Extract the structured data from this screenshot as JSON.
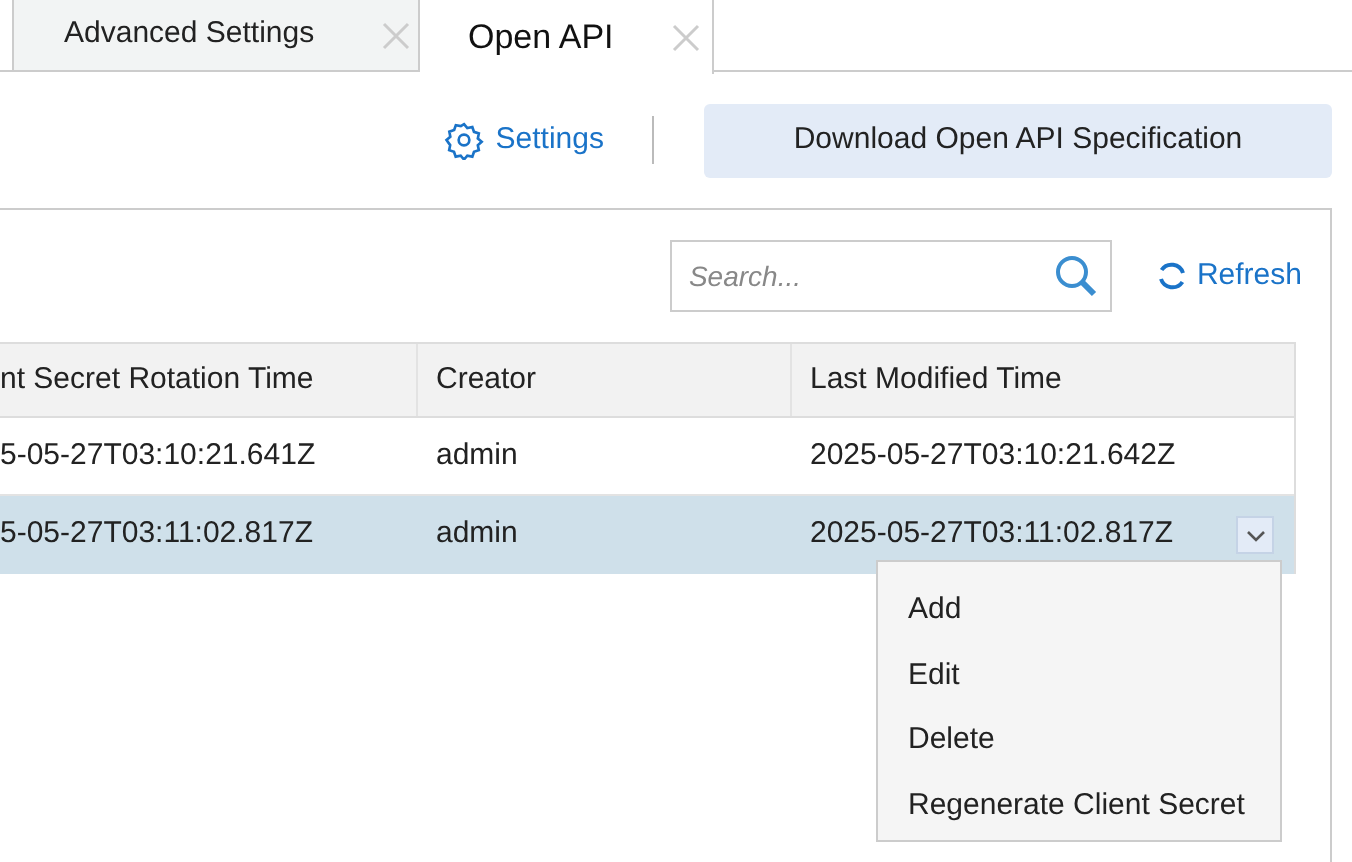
{
  "tabs": [
    {
      "label": "Advanced Settings",
      "selected": false
    },
    {
      "label": "Open API",
      "selected": true
    }
  ],
  "toolbar": {
    "settings_link": "Settings",
    "download_button": "Download Open API Specification"
  },
  "search": {
    "placeholder": "Search..."
  },
  "refresh_link": "Refresh",
  "table": {
    "columns": [
      "nt Secret Rotation Time",
      "Creator",
      "Last Modified Time"
    ],
    "rows": [
      {
        "cells": [
          "5-05-27T03:10:21.641Z",
          "admin",
          "2025-05-27T03:10:21.642Z"
        ],
        "selected": false
      },
      {
        "cells": [
          "5-05-27T03:11:02.817Z",
          "admin",
          "2025-05-27T03:11:02.817Z"
        ],
        "selected": true
      }
    ]
  },
  "context_menu": {
    "items": [
      "Add",
      "Edit",
      "Delete",
      "Regenerate Client Secret"
    ]
  }
}
